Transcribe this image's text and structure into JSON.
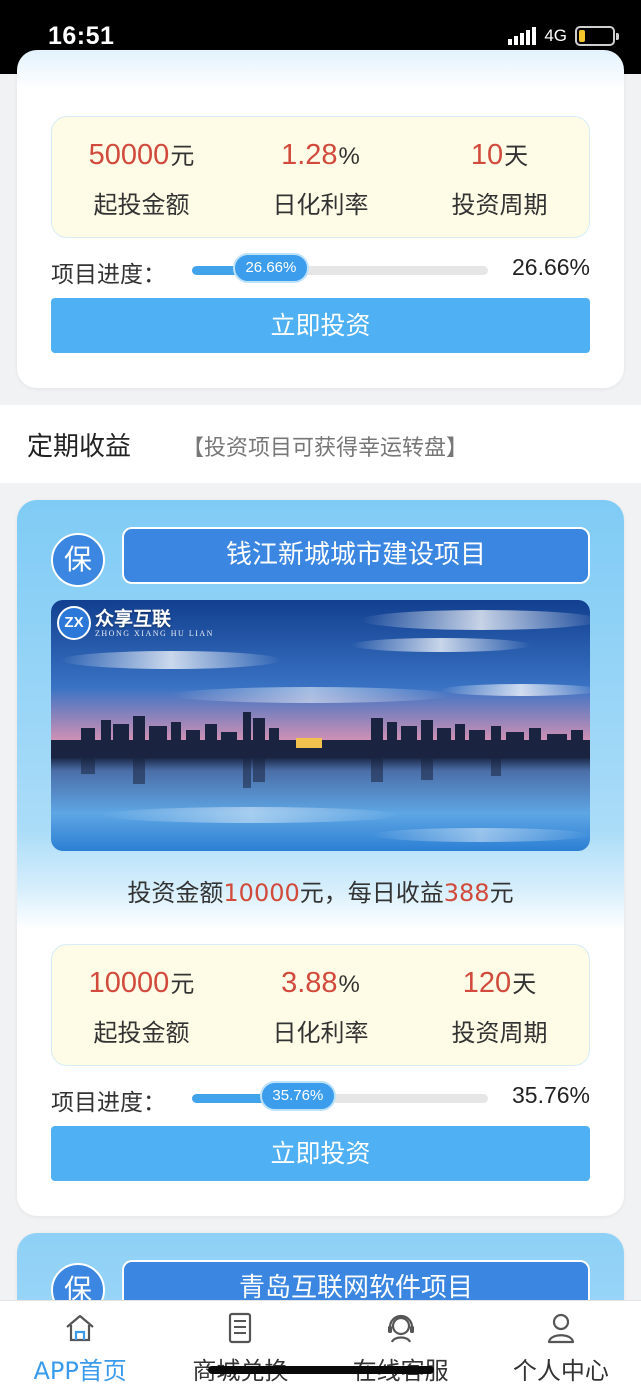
{
  "status_bar": {
    "time": "16:51",
    "network": "4G"
  },
  "products": [
    {
      "stats": [
        {
          "value": "50000",
          "unit": "元",
          "label": "起投金额"
        },
        {
          "value": "1.28",
          "unit": "%",
          "label": "日化利率"
        },
        {
          "value": "10",
          "unit": "天",
          "label": "投资周期"
        }
      ],
      "progress": {
        "label": "项目进度：",
        "percent": 26.66,
        "pill_text": "26.66%",
        "value_text": "26.66%"
      },
      "invest_button": "立即投资"
    },
    {
      "badge": "保",
      "title": "钱江新城城市建设项目",
      "banner": {
        "logo_mark": "ZX",
        "logo_name": "众享互联",
        "logo_pinyin": "ZHONG XIANG HU LIAN"
      },
      "summary": {
        "prefix": "投资金额",
        "amount": "10000",
        "middle": "元，每日收益",
        "daily": "388",
        "suffix": "元"
      },
      "stats": [
        {
          "value": "10000",
          "unit": "元",
          "label": "起投金额"
        },
        {
          "value": "3.88",
          "unit": "%",
          "label": "日化利率"
        },
        {
          "value": "120",
          "unit": "天",
          "label": "投资周期"
        }
      ],
      "progress": {
        "label": "项目进度：",
        "percent": 35.76,
        "pill_text": "35.76%",
        "value_text": "35.76%"
      },
      "invest_button": "立即投资"
    },
    {
      "badge": "保",
      "title": "青岛互联网软件项目"
    }
  ],
  "section": {
    "title": "定期收益",
    "subtitle": "【投资项目可获得幸运转盘】"
  },
  "bottom_nav": [
    {
      "label": "APP首页",
      "icon": "home-icon",
      "active": true
    },
    {
      "label": "商城兑换",
      "icon": "document-icon",
      "active": false
    },
    {
      "label": "在线客服",
      "icon": "customer-service-icon",
      "active": false
    },
    {
      "label": "个人中心",
      "icon": "user-icon",
      "active": false
    }
  ],
  "colors": {
    "accent": "#3a86e1",
    "button": "#4fb0f3",
    "value_red": "#d24a3b",
    "nav_active": "#3a9bec"
  }
}
